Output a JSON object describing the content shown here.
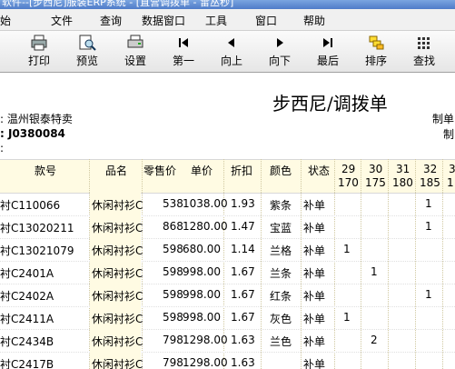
{
  "window": {
    "title": "软件--[步西尼]服装ERP系统 - [直营调拨单 - 雷丛秒]"
  },
  "menu": [
    "始",
    "文件",
    "查询",
    "数据窗口",
    "工具",
    "窗口",
    "帮助"
  ],
  "toolbar": [
    {
      "label": "打印",
      "icon": "printer-icon"
    },
    {
      "label": "预览",
      "icon": "preview-icon"
    },
    {
      "label": "设置",
      "icon": "page-setup-icon"
    },
    {
      "label": "第一",
      "icon": "first-record-icon"
    },
    {
      "label": "向上",
      "icon": "previous-record-icon"
    },
    {
      "label": "向下",
      "icon": "next-record-icon"
    },
    {
      "label": "最后",
      "icon": "last-record-icon"
    },
    {
      "label": "排序",
      "icon": "sort-icon"
    },
    {
      "label": "查找",
      "icon": "find-icon"
    }
  ],
  "report": {
    "title": "步西尼/调拨单",
    "store": ": 温州银泰特卖",
    "doc_no": ": J0380084",
    "colon_line": ":",
    "right_label_1": "制单",
    "right_label_2": "制"
  },
  "columns": {
    "code": "款号",
    "name": "品名",
    "price": "零售价",
    "unit": "单价",
    "disc": "折扣",
    "color": "颜色",
    "status": "状态",
    "sizes": [
      {
        "top": "29",
        "bottom": "170"
      },
      {
        "top": "30",
        "bottom": "175"
      },
      {
        "top": "31",
        "bottom": "180"
      },
      {
        "top": "32",
        "bottom": "185"
      },
      {
        "top": "3",
        "bottom": "1"
      }
    ]
  },
  "rows": [
    {
      "code": "衬C110066",
      "name": "休闲衬衫C",
      "price": "538",
      "unit": "1038.00",
      "disc": "1.93",
      "color": "紫条",
      "status": "补单",
      "s29": "",
      "s30": "",
      "s31": "",
      "s32": "1"
    },
    {
      "code": "衬C13020211",
      "name": "休闲衬衫C",
      "price": "868",
      "unit": "1280.00",
      "disc": "1.47",
      "color": "宝蓝",
      "status": "补单",
      "s29": "",
      "s30": "",
      "s31": "",
      "s32": "1"
    },
    {
      "code": "衬C13021079",
      "name": "休闲衬衫C",
      "price": "598",
      "unit": "680.00",
      "disc": "1.14",
      "color": "兰格",
      "status": "补单",
      "s29": "1",
      "s30": "",
      "s31": "",
      "s32": ""
    },
    {
      "code": "衬C2401A",
      "name": "休闲衬衫C",
      "price": "598",
      "unit": "998.00",
      "disc": "1.67",
      "color": "兰条",
      "status": "补单",
      "s29": "",
      "s30": "1",
      "s31": "",
      "s32": ""
    },
    {
      "code": "衬C2402A",
      "name": "休闲衬衫C",
      "price": "598",
      "unit": "998.00",
      "disc": "1.67",
      "color": "红条",
      "status": "补单",
      "s29": "",
      "s30": "",
      "s31": "",
      "s32": "1"
    },
    {
      "code": "衬C2411A",
      "name": "休闲衬衫C",
      "price": "598",
      "unit": "998.00",
      "disc": "1.67",
      "color": "灰色",
      "status": "补单",
      "s29": "1",
      "s30": "",
      "s31": "",
      "s32": ""
    },
    {
      "code": "衬C2434B",
      "name": "休闲衬衫C",
      "price": "798",
      "unit": "1298.00",
      "disc": "1.63",
      "color": "兰色",
      "status": "补单",
      "s29": "",
      "s30": "2",
      "s31": "",
      "s32": ""
    },
    {
      "code": "衬C2417B",
      "name": "休闲衬衫C",
      "price": "798",
      "unit": "1298.00",
      "disc": "1.63",
      "color": "",
      "status": "补单",
      "s29": "",
      "s30": "",
      "s31": "",
      "s32": ""
    }
  ]
}
